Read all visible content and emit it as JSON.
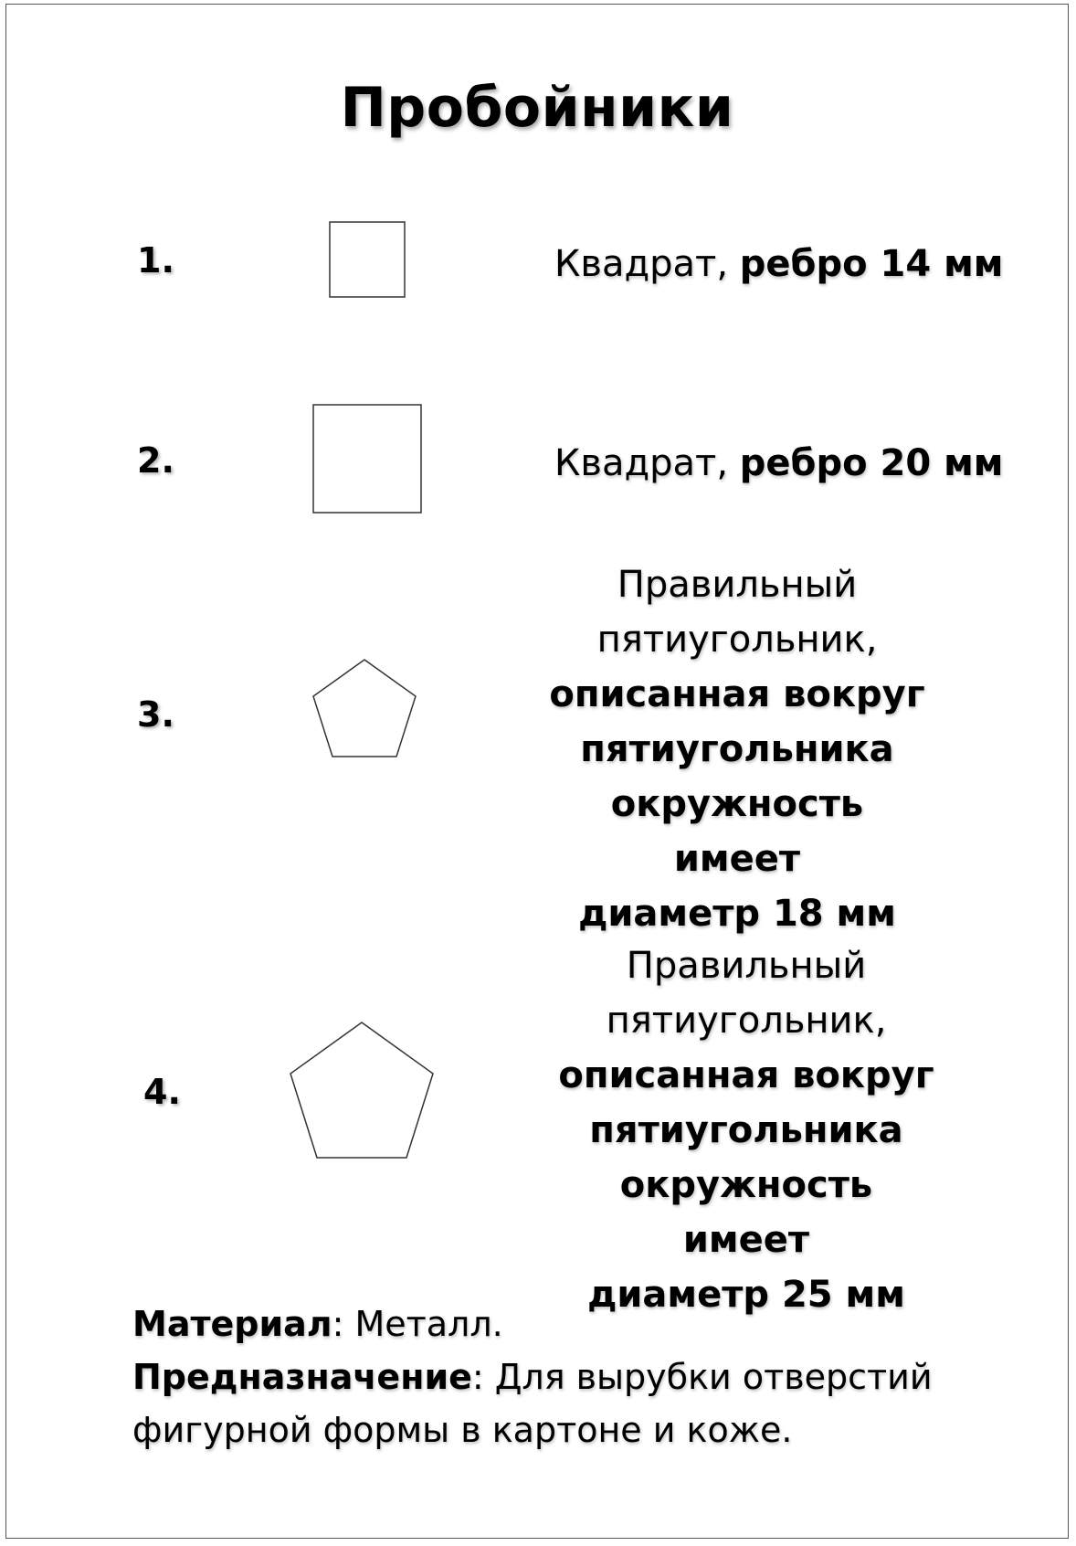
{
  "title": "Пробойники",
  "items": [
    {
      "number": "1.",
      "shape": "square-shape",
      "text_plain": "Квадрат, ",
      "text_bold": "ребро 14 мм"
    },
    {
      "number": "2.",
      "shape": "square-shape",
      "text_plain": "Квадрат, ",
      "text_bold": "ребро 20 мм"
    },
    {
      "number": "3.",
      "shape": "pentagon-shape",
      "plain_lines": [
        "Правильный",
        "пятиугольник,"
      ],
      "bold_lines": [
        "описанная вокруг",
        "пятиугольника",
        "окружность имеет",
        "диаметр 18 мм"
      ]
    },
    {
      "number": "4.",
      "shape": "pentagon-shape",
      "plain_lines": [
        "Правильный",
        "пятиугольник,"
      ],
      "bold_lines": [
        "описанная вокруг",
        "пятиугольника",
        "окружность имеет",
        "диаметр 25 мм"
      ]
    }
  ],
  "footer": {
    "material_label": "Материал",
    "material_value": ": Металл.",
    "purpose_label": "Предназначение",
    "purpose_value_line1": ": Для вырубки отверстий",
    "purpose_value_line2": "фигурной формы в картоне и коже."
  }
}
